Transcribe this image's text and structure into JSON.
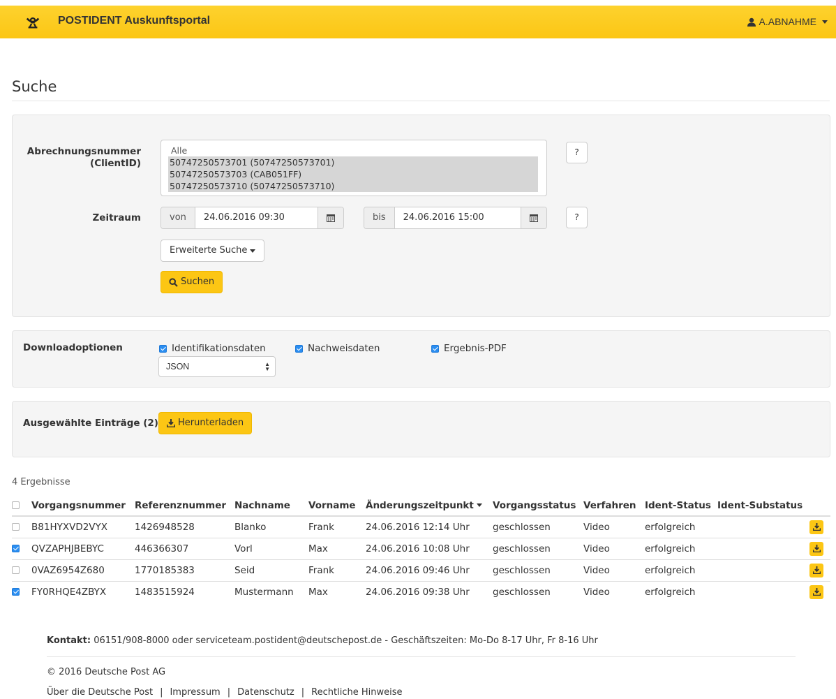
{
  "header": {
    "brand": "POSTIDENT Auskunftsportal",
    "user": "A.ABNAHME",
    "logo_icon": "posthorn-icon",
    "brand_color": "#fcc614"
  },
  "page": {
    "title": "Suche"
  },
  "search": {
    "client_label_1": "Abrechnungsnummer",
    "client_label_2": "(ClientID)",
    "client_options": [
      {
        "label": "Alle",
        "selected": false
      },
      {
        "label": "50747250573701 (50747250573701)",
        "selected": true
      },
      {
        "label": "50747250573703 (CAB051FF)",
        "selected": true
      },
      {
        "label": "50747250573710 (50747250573710)",
        "selected": true
      }
    ],
    "help_label": "?",
    "zeitraum_label": "Zeitraum",
    "von_label": "von",
    "von_value": "24.06.2016 09:30",
    "bis_label": "bis",
    "bis_value": "24.06.2016 15:00",
    "advanced_label": "Erweiterte Suche",
    "search_button": "Suchen"
  },
  "download_options": {
    "label": "Downloadoptionen",
    "options": [
      {
        "label": "Identifikationsdaten",
        "checked": true
      },
      {
        "label": "Nachweisdaten",
        "checked": true
      },
      {
        "label": "Ergebnis-PDF",
        "checked": true
      }
    ],
    "format": "JSON"
  },
  "selection": {
    "label": "Ausgewählte Einträge (2)",
    "download_button": "Herunterladen"
  },
  "results": {
    "count_label": "4 Ergebnisse",
    "columns": [
      "Vorgangsnummer",
      "Referenznummer",
      "Nachname",
      "Vorname",
      "Änderungszeitpunkt",
      "Vorgangsstatus",
      "Verfahren",
      "Ident-Status",
      "Ident-Substatus"
    ],
    "rows": [
      {
        "checked": false,
        "cells": [
          "B81HYXVD2VYX",
          "1426948528",
          "Blanko",
          "Frank",
          "24.06.2016 12:14 Uhr",
          "geschlossen",
          "Video",
          "erfolgreich",
          ""
        ]
      },
      {
        "checked": true,
        "cells": [
          "QVZAPHJBEBYC",
          "446366307",
          "Vorl",
          "Max",
          "24.06.2016 10:08 Uhr",
          "geschlossen",
          "Video",
          "erfolgreich",
          ""
        ]
      },
      {
        "checked": false,
        "cells": [
          "0VAZ6954Z680",
          "1770185383",
          "Seid",
          "Frank",
          "24.06.2016 09:46 Uhr",
          "geschlossen",
          "Video",
          "erfolgreich",
          ""
        ]
      },
      {
        "checked": true,
        "cells": [
          "FY0RHQE4ZBYX",
          "1483515924",
          "Mustermann",
          "Max",
          "24.06.2016 09:38 Uhr",
          "geschlossen",
          "Video",
          "erfolgreich",
          ""
        ]
      }
    ]
  },
  "footer": {
    "kontakt_label": "Kontakt:",
    "kontakt_text": " 06151/908-8000 oder serviceteam.postident@deutschepost.de - Geschäftszeiten: Mo-Do 8-17 Uhr, Fr 8-16 Uhr",
    "copyright": "© 2016 Deutsche Post AG",
    "links": [
      "Über die Deutsche Post",
      "Impressum",
      "Datenschutz",
      "Rechtliche Hinweise"
    ],
    "separator": "|"
  }
}
